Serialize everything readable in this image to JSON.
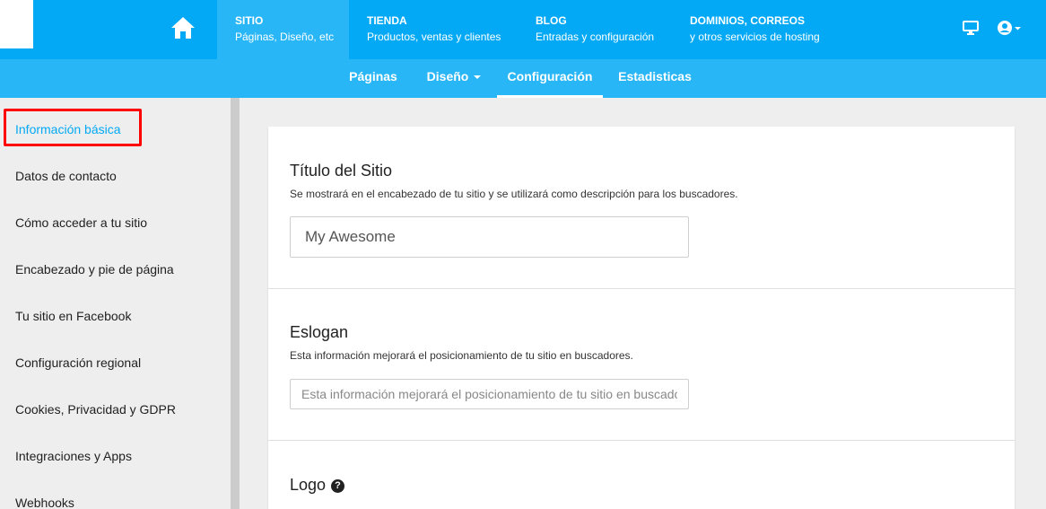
{
  "topnav": {
    "items": [
      {
        "title": "SITIO",
        "subtitle": "Páginas, Diseño, etc"
      },
      {
        "title": "TIENDA",
        "subtitle": "Productos, ventas y clientes"
      },
      {
        "title": "BLOG",
        "subtitle": "Entradas y configuración"
      },
      {
        "title": "DOMINIOS, CORREOS",
        "subtitle": "y otros servicios de hosting"
      }
    ],
    "icons": [
      "home-icon",
      "monitor-icon",
      "user-circle-icon"
    ]
  },
  "subnav": {
    "tabs": [
      {
        "label": "Páginas"
      },
      {
        "label": "Diseño"
      },
      {
        "label": "Configuración"
      },
      {
        "label": "Estadisticas"
      }
    ]
  },
  "sidebar": {
    "items": [
      {
        "label": "Información básica"
      },
      {
        "label": "Datos de contacto"
      },
      {
        "label": "Cómo acceder a tu sitio"
      },
      {
        "label": "Encabezado y pie de página"
      },
      {
        "label": "Tu sitio en Facebook"
      },
      {
        "label": "Configuración regional"
      },
      {
        "label": "Cookies, Privacidad y GDPR"
      },
      {
        "label": "Integraciones y Apps"
      },
      {
        "label": "Webhooks"
      }
    ]
  },
  "main": {
    "site_title": {
      "heading": "Título del Sitio",
      "description": "Se mostrará en el encabezado de tu sitio y se utilizará como descripción para los buscadores.",
      "value": "My Awesome"
    },
    "slogan": {
      "heading": "Eslogan",
      "description": "Esta información mejorará el posicionamiento de tu sitio en buscadores.",
      "placeholder": "Esta información mejorará el posicionamiento de tu sitio en buscadores."
    },
    "logo": {
      "heading": "Logo",
      "help_glyph": "?"
    }
  },
  "colors": {
    "topbar": "#03a9f4",
    "active_nav": "#29b6f6",
    "highlight": "#ff0000"
  }
}
